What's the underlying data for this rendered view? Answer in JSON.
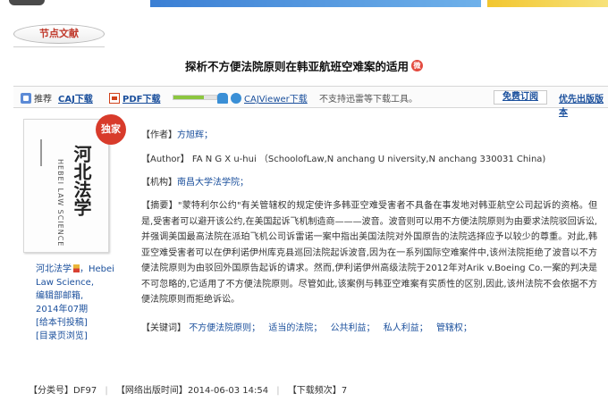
{
  "header": {
    "section_tab": "节点文献",
    "article_title": "探析不方便法院原则在韩亚航班空难案的适用",
    "weibo_icon": "weibo-icon"
  },
  "toolbar": {
    "recommend": "推荐",
    "caj_download": "CAJ下载",
    "pdf_download": "PDF下载",
    "pdf_progress": 0.7,
    "cajviewer_download": "CAJViewer下载",
    "notice": "不支持迅雷等下载工具。",
    "subscribe": "免费订阅",
    "first_publish": "优先出版版本"
  },
  "cover": {
    "stamp": "独家",
    "title_cn": "河北法学",
    "title_en": "HEBEI LAW SCIENCE"
  },
  "journal": {
    "name": "河北法学",
    "name_suffix": "，Hebei Law Science,",
    "editor": "编辑部邮箱,",
    "issue": "2014年07期",
    "submit": "[给本刊投稿]",
    "toc": "[目录页浏览]"
  },
  "meta": {
    "author_label": "【作者】",
    "author": "方旭辉；",
    "author_en_label": "【Author】",
    "author_en": "FA N G X u-hui （SchoolofLaw,N anchang U niversity,N anchang 330031 China)",
    "org_label": "【机构】",
    "org": "南昌大学法学院；",
    "abstract_label": "【摘要】",
    "abstract": "\"蒙特利尔公约\"有关管辖权的规定使许多韩亚空难受害者不具备在事发地对韩亚航空公司起诉的资格。但是,受害者可以避开该公约,在美国起诉飞机制造商———波音。波音则可以用不方便法院原则为由要求法院驳回诉讼,并强调美国最高法院在派珀飞机公司诉雷诺一案中指出美国法院对外国原告的法院选择应予以较少的尊重。对此,韩亚空难受害者可以在伊利诺伊州库克县巡回法院起诉波音,因为在一系列国际空难案件中,该州法院拒绝了波音以不方便法院原则为由驳回外国原告起诉的请求。然而,伊利诺伊州高级法院于2012年对Arik v.Boeing Co.一案的判决是不可忽略的,它适用了不方便法院原则。尽管如此,该案例与韩亚空难案有实质性的区别,因此,该州法院不会依据不方便法院原则而拒绝诉讼。",
    "keywords_label": "【关键词】",
    "keywords": [
      "不方便法院原则；",
      "适当的法院；",
      "公共利益；",
      "私人利益；",
      "管辖权；"
    ]
  },
  "footer": {
    "class_label": "【分类号】",
    "class_value": "DF97",
    "online_label": "【网络出版时间】",
    "online_value": "2014-06-03 14:54",
    "downloads_label": "【下载频次】",
    "downloads_value": "7"
  }
}
